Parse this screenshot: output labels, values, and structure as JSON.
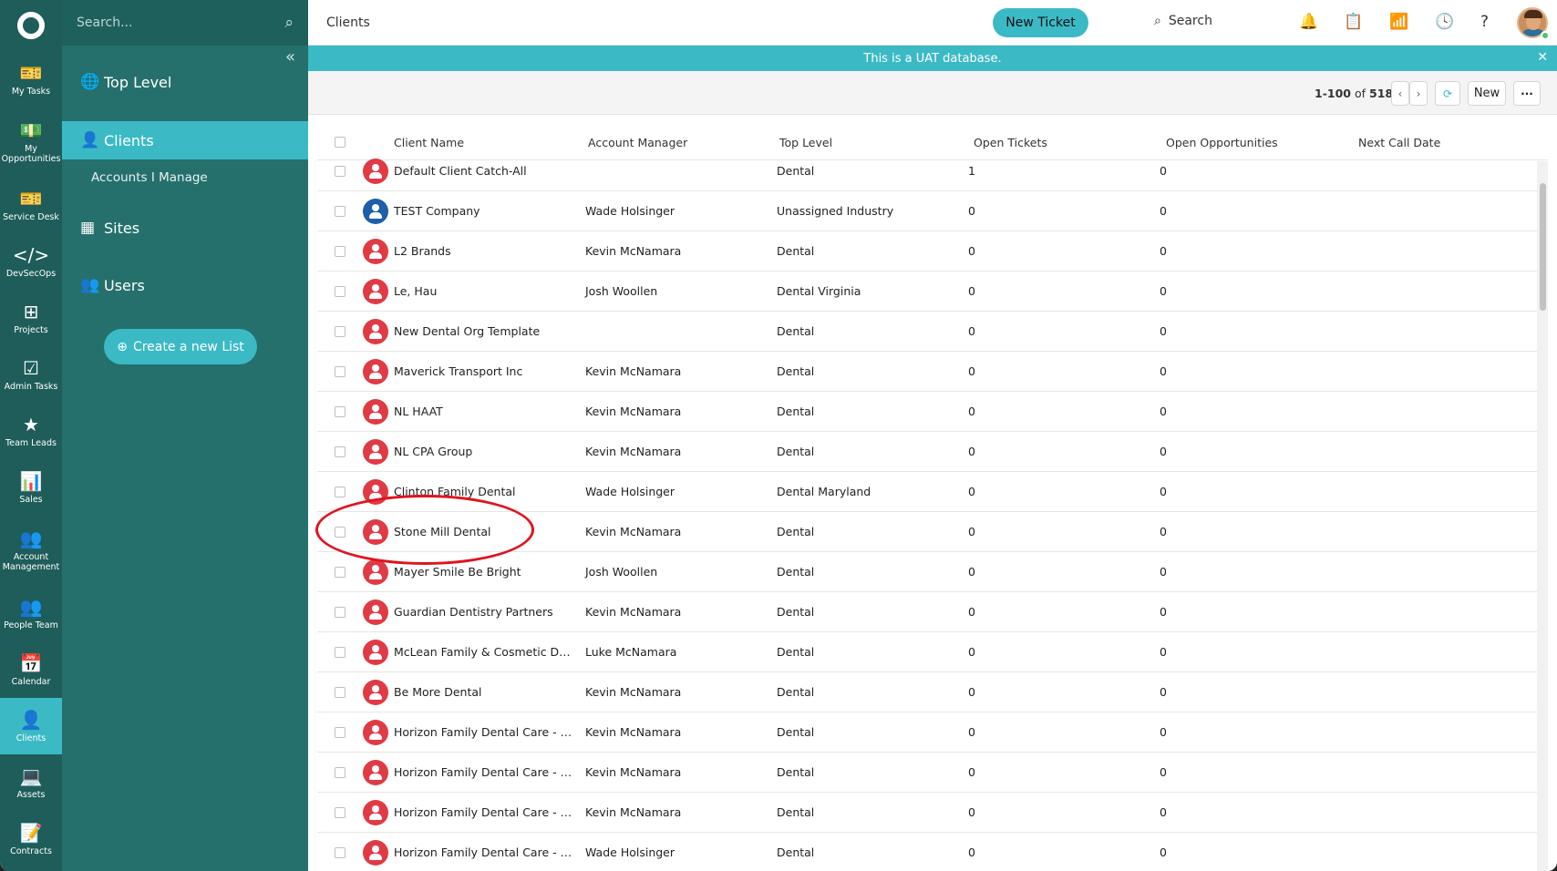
{
  "rail": [
    {
      "label": "My Tasks",
      "icon": "ticket-icon",
      "glyph": "🎫"
    },
    {
      "label": "My Opportunities",
      "icon": "money-icon",
      "glyph": "💵"
    },
    {
      "label": "Service Desk",
      "icon": "ticket-icon",
      "glyph": "🎫"
    },
    {
      "label": "DevSecOps",
      "icon": "code-icon",
      "glyph": "</>"
    },
    {
      "label": "Projects",
      "icon": "hierarchy-icon",
      "glyph": "⊞"
    },
    {
      "label": "Admin Tasks",
      "icon": "checkbox-icon",
      "glyph": "☑"
    },
    {
      "label": "Team Leads",
      "icon": "star-icon",
      "glyph": "★"
    },
    {
      "label": "Sales",
      "icon": "chart-icon",
      "glyph": "📊"
    },
    {
      "label": "Account Management",
      "icon": "group-icon",
      "glyph": "👥"
    },
    {
      "label": "People Team",
      "icon": "group-icon",
      "glyph": "👥"
    },
    {
      "label": "Calendar",
      "icon": "calendar-icon",
      "glyph": "📅"
    },
    {
      "label": "Clients",
      "icon": "user-icon",
      "glyph": "👤"
    },
    {
      "label": "Assets",
      "icon": "laptop-icon",
      "glyph": "💻"
    },
    {
      "label": "Contracts",
      "icon": "contract-icon",
      "glyph": "📝"
    }
  ],
  "sidebar": {
    "search_placeholder": "Search...",
    "top_level": "Top Level",
    "clients": "Clients",
    "accounts_i_manage": "Accounts I Manage",
    "sites": "Sites",
    "users": "Users",
    "create_list": "Create a new List"
  },
  "topbar": {
    "breadcrumb": "Clients",
    "new_ticket": "New Ticket",
    "search": "Search"
  },
  "banner": "This is a UAT database.",
  "toolbar": {
    "range": "1-100",
    "of": "of",
    "total": "518",
    "new_label": "New",
    "more": "···"
  },
  "table": {
    "headers": {
      "name": "Client Name",
      "manager": "Account Manager",
      "top_level": "Top Level",
      "open_tickets": "Open Tickets",
      "open_opps": "Open Opportunities",
      "next_call": "Next Call Date"
    },
    "rows": [
      {
        "name": "Default Client Catch-All",
        "manager": "",
        "top": "Dental",
        "open": "1",
        "opp": "0",
        "color": "red"
      },
      {
        "name": "TEST Company",
        "manager": "Wade Holsinger",
        "top": "Unassigned Industry",
        "open": "0",
        "opp": "0",
        "color": "blue"
      },
      {
        "name": "L2 Brands",
        "manager": "Kevin McNamara",
        "top": "Dental",
        "open": "0",
        "opp": "0",
        "color": "red"
      },
      {
        "name": "Le, Hau",
        "manager": "Josh Woollen",
        "top": "Dental Virginia",
        "open": "0",
        "opp": "0",
        "color": "red"
      },
      {
        "name": "New Dental Org Template",
        "manager": "",
        "top": "Dental",
        "open": "0",
        "opp": "0",
        "color": "red"
      },
      {
        "name": "Maverick Transport Inc",
        "manager": "Kevin McNamara",
        "top": "Dental",
        "open": "0",
        "opp": "0",
        "color": "red"
      },
      {
        "name": "NL HAAT",
        "manager": "Kevin McNamara",
        "top": "Dental",
        "open": "0",
        "opp": "0",
        "color": "red"
      },
      {
        "name": "NL CPA Group",
        "manager": "Kevin McNamara",
        "top": "Dental",
        "open": "0",
        "opp": "0",
        "color": "red"
      },
      {
        "name": "Clinton Family Dental",
        "manager": "Wade Holsinger",
        "top": "Dental Maryland",
        "open": "0",
        "opp": "0",
        "color": "red"
      },
      {
        "name": "Stone Mill Dental",
        "manager": "Kevin McNamara",
        "top": "Dental",
        "open": "0",
        "opp": "0",
        "color": "red"
      },
      {
        "name": "Mayer Smile Be Bright",
        "manager": "Josh Woollen",
        "top": "Dental",
        "open": "0",
        "opp": "0",
        "color": "red"
      },
      {
        "name": "Guardian Dentistry Partners",
        "manager": "Kevin McNamara",
        "top": "Dental",
        "open": "0",
        "opp": "0",
        "color": "red"
      },
      {
        "name": "McLean Family & Cosmetic Dentis...",
        "manager": "Luke McNamara",
        "top": "Dental",
        "open": "0",
        "opp": "0",
        "color": "red"
      },
      {
        "name": "Be More Dental",
        "manager": "Kevin McNamara",
        "top": "Dental",
        "open": "0",
        "opp": "0",
        "color": "red"
      },
      {
        "name": "Horizon Family Dental Care - Clint...",
        "manager": "Kevin McNamara",
        "top": "Dental",
        "open": "0",
        "opp": "0",
        "color": "red"
      },
      {
        "name": "Horizon Family Dental Care - La Pl...",
        "manager": "Kevin McNamara",
        "top": "Dental",
        "open": "0",
        "opp": "0",
        "color": "red"
      },
      {
        "name": "Horizon Family Dental Care - Balti...",
        "manager": "Kevin McNamara",
        "top": "Dental",
        "open": "0",
        "opp": "0",
        "color": "red"
      },
      {
        "name": "Horizon Family Dental Care - Ga...",
        "manager": "Wade Holsinger",
        "top": "Dental",
        "open": "0",
        "opp": "0",
        "color": "red"
      }
    ]
  },
  "colors": {
    "rail": "#1e5d5a",
    "sidebar": "#25706c",
    "accent": "#3bbac6",
    "client_red": "#e03a45",
    "client_blue": "#1d5fa8",
    "highlight": "#e0141e"
  }
}
